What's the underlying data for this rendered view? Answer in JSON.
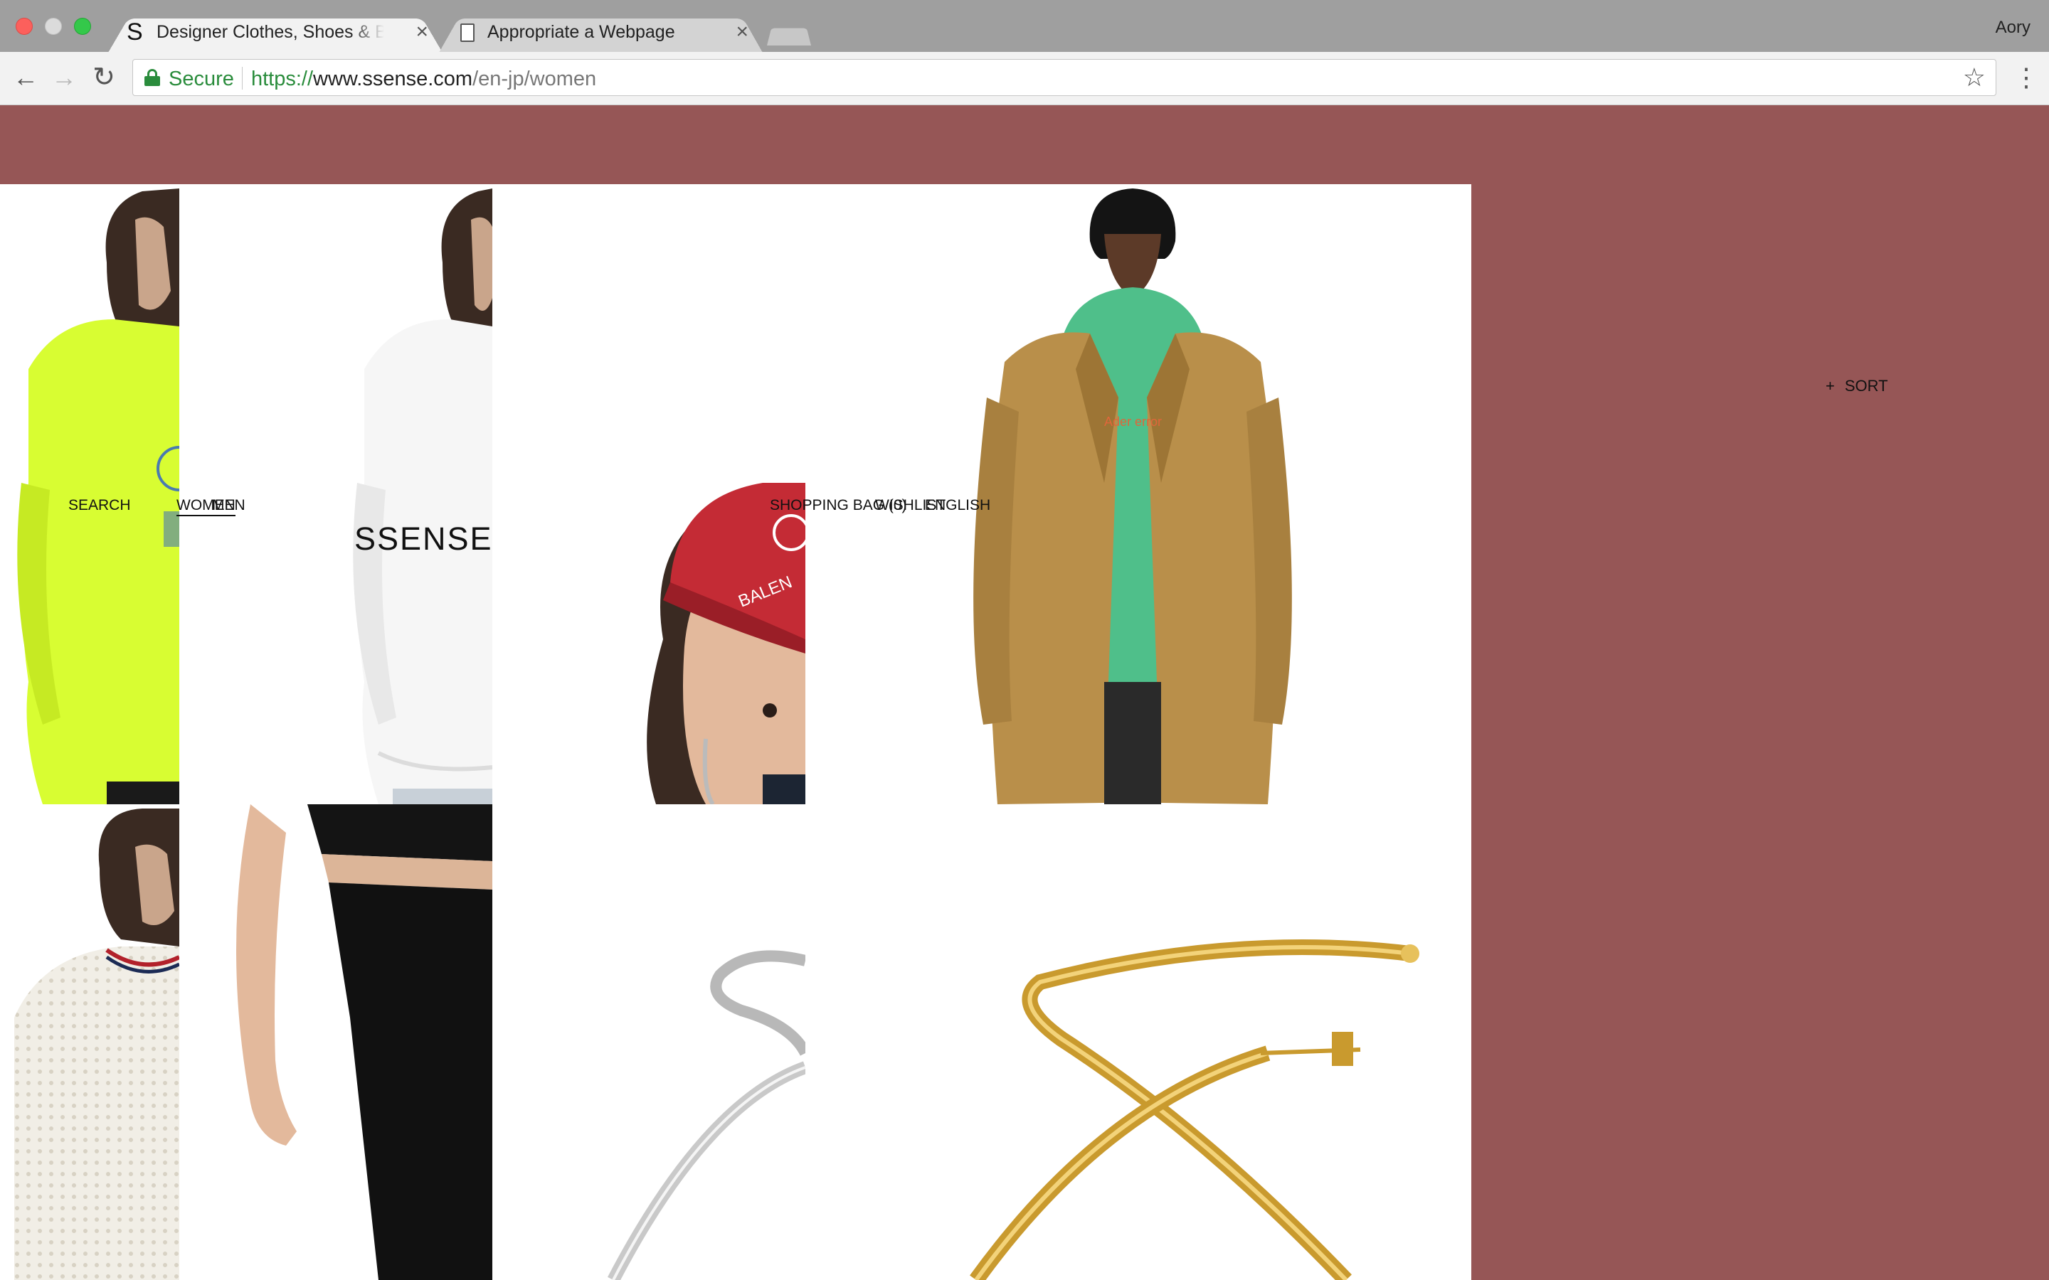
{
  "browser": {
    "tabs": [
      {
        "favicon": "S",
        "title": "Designer Clothes, Shoes & Bags for Women | SSENSE",
        "close": "×"
      },
      {
        "favicon": "page-icon",
        "title": "Appropriate a Webpage",
        "close": "×"
      }
    ],
    "profile_name": "Aory",
    "nav": {
      "back": "←",
      "forward": "→",
      "reload": "↻"
    },
    "omnibox": {
      "secure_label": "Secure",
      "url_scheme": "https://",
      "url_host": "www.ssense.com",
      "url_path": "/en-jp/women"
    },
    "star": "☆",
    "menu": "⋮"
  },
  "site": {
    "logo": "SSENSE",
    "nav": {
      "search": "SEARCH",
      "women": "WOMEN",
      "men": "MEN",
      "shopping_bag": "SHOPPING BAG (0)",
      "wishlist": "WISHLIST",
      "language": "ENGLISH"
    },
    "sort": {
      "icon": "+",
      "label": "SORT"
    },
    "colors": {
      "background": "#965656",
      "panel": "#ffffff"
    }
  },
  "products": [
    {
      "image": "lime green logo hoodie"
    },
    {
      "image": "white logo hoodie"
    },
    {
      "image": "red logo cap"
    },
    {
      "image": "camel wool coat over green hoodie"
    },
    {
      "image": "white open-knit sweater"
    },
    {
      "image": "black cropped top and skirt"
    },
    {
      "image": "silver twisted hoop earring"
    },
    {
      "image": "gold twisted hoop earring"
    }
  ]
}
